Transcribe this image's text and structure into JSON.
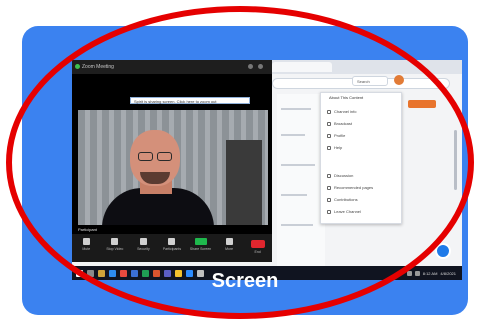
{
  "card": {
    "label": "Screen",
    "color": "#3b82f0"
  },
  "browser": {
    "search_placeholder": "Search",
    "panel": {
      "title": "About This Content",
      "items": [
        "Channel info",
        "Broadcast",
        "Profile",
        "Help",
        "Discussion",
        "Recommended pages",
        "Contributions",
        "Leave Channel"
      ]
    }
  },
  "zoom": {
    "window_title": "Zoom Meeting",
    "toast": "Spirit is sharing screen. Click here to zoom out",
    "participant_name": "Participant",
    "toolbar": [
      "Mute",
      "Stop Video",
      "Security",
      "Participants",
      "Share Screen",
      "More"
    ],
    "end_label": "End"
  },
  "taskbar": {
    "time": "8:12 AM",
    "date": "4/8/2021"
  },
  "annotation": {
    "color": "#e50000"
  }
}
